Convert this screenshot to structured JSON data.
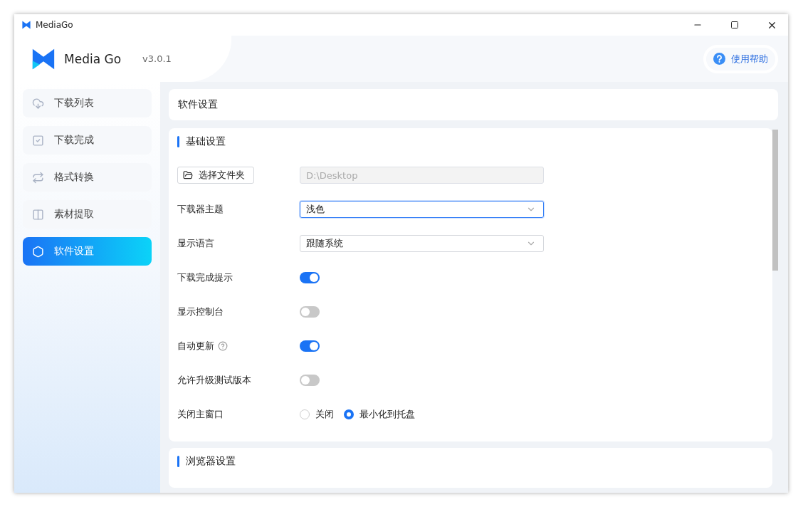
{
  "window": {
    "title": "MediaGo"
  },
  "header": {
    "app_name": "Media Go",
    "version": "v3.0.1",
    "help": "使用帮助"
  },
  "sidebar": {
    "items": [
      {
        "label": "下载列表",
        "selected": false
      },
      {
        "label": "下载完成",
        "selected": false
      },
      {
        "label": "格式转换",
        "selected": false
      },
      {
        "label": "素材提取",
        "selected": false
      },
      {
        "label": "软件设置",
        "selected": true
      }
    ]
  },
  "page_title": "软件设置",
  "sections": [
    {
      "title": "基础设置",
      "rows": [
        {
          "kind": "folder",
          "button": "选择文件夹",
          "value": "D:\\Desktop",
          "disabled": true
        },
        {
          "kind": "select",
          "label": "下载器主题",
          "value": "浅色",
          "focused": true
        },
        {
          "kind": "select",
          "label": "显示语言",
          "value": "跟随系统",
          "focused": false
        },
        {
          "kind": "toggle",
          "label": "下载完成提示",
          "on": true
        },
        {
          "kind": "toggle",
          "label": "显示控制台",
          "on": false
        },
        {
          "kind": "toggle",
          "label": "自动更新",
          "on": true,
          "help": true
        },
        {
          "kind": "toggle",
          "label": "允许升级测试版本",
          "on": false
        },
        {
          "kind": "radio",
          "label": "关闭主窗口",
          "options": [
            {
              "label": "关闭",
              "selected": false
            },
            {
              "label": "最小化到托盘",
              "selected": true
            }
          ]
        }
      ]
    },
    {
      "title": "浏览器设置"
    }
  ]
}
